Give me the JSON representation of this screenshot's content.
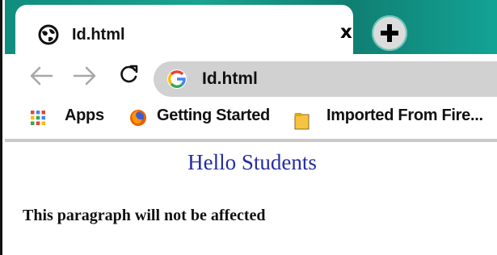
{
  "tab": {
    "title": "Id.html",
    "close_label": "x",
    "icon": "globe-icon"
  },
  "new_tab": {
    "label": "+",
    "icon": "plus-icon"
  },
  "toolbar": {
    "back_icon": "arrow-left-icon",
    "forward_icon": "arrow-right-icon",
    "reload_icon": "reload-icon",
    "address": "Id.html",
    "address_icon": "google-g-icon"
  },
  "bookmarks": [
    {
      "label": "Apps",
      "icon": "apps-grid-icon"
    },
    {
      "label": "Getting Started",
      "icon": "firefox-icon"
    },
    {
      "label": "Imported From Fire...",
      "icon": "folder-icon"
    }
  ],
  "page": {
    "heading": "Hello Students",
    "paragraph": "This paragraph will not be affected"
  },
  "colors": {
    "tabstrip": "#13a495",
    "heading": "#262ca0",
    "omnibox": "#d1d1d1"
  }
}
